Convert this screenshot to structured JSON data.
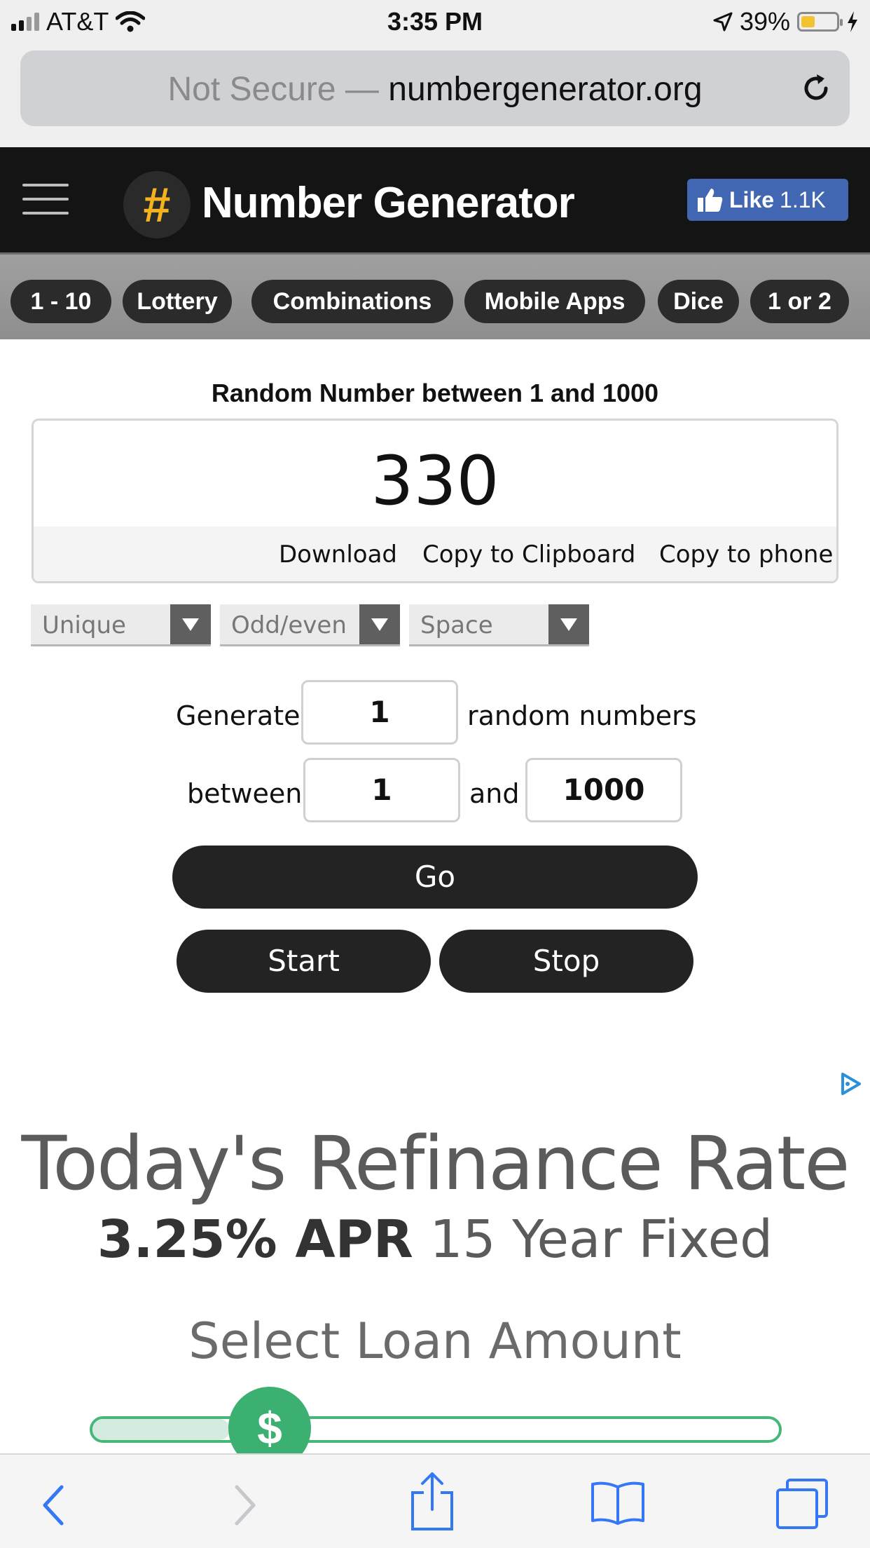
{
  "status_bar": {
    "carrier": "AT&T",
    "time": "3:35 PM",
    "battery": "39%",
    "battery_level": 0.39
  },
  "address_bar": {
    "security": "Not Secure —",
    "domain": "numbergenerator.org"
  },
  "header": {
    "logo_symbol": "#",
    "brand": "Number Generator",
    "fb_like_label": "Like",
    "fb_like_count": "1.1K"
  },
  "categories": [
    "1 - 10",
    "Lottery",
    "Combinations",
    "Mobile Apps",
    "Dice",
    "1 or 2"
  ],
  "generator": {
    "title": "Random Number between 1 and 1000",
    "result": "330",
    "actions": {
      "download": "Download",
      "copy_clipboard": "Copy to Clipboard",
      "copy_phone": "Copy to phone"
    },
    "dropdowns": {
      "unique": "Unique",
      "odd_even": "Odd/even",
      "space": "Space"
    },
    "form": {
      "generate_label": "Generate",
      "count": "1",
      "count_suffix": "random numbers",
      "between_label": "between",
      "min": "1",
      "and_label": "and",
      "max": "1000"
    },
    "buttons": {
      "go": "Go",
      "start": "Start",
      "stop": "Stop"
    }
  },
  "ad": {
    "headline": "Today's Refinance Rate",
    "rate_bold": "3.25% APR",
    "rate_rest": "15 Year Fixed",
    "select_label": "Select Loan Amount",
    "slider_symbol": "$",
    "slider_level": 0.2
  },
  "colors": {
    "header_bg": "#141414",
    "logo_accent": "#f4b31e",
    "fb_blue": "#4267b2",
    "button_dark": "#232323",
    "slider_green": "#3bb071",
    "safari_blue": "#3478f6"
  }
}
